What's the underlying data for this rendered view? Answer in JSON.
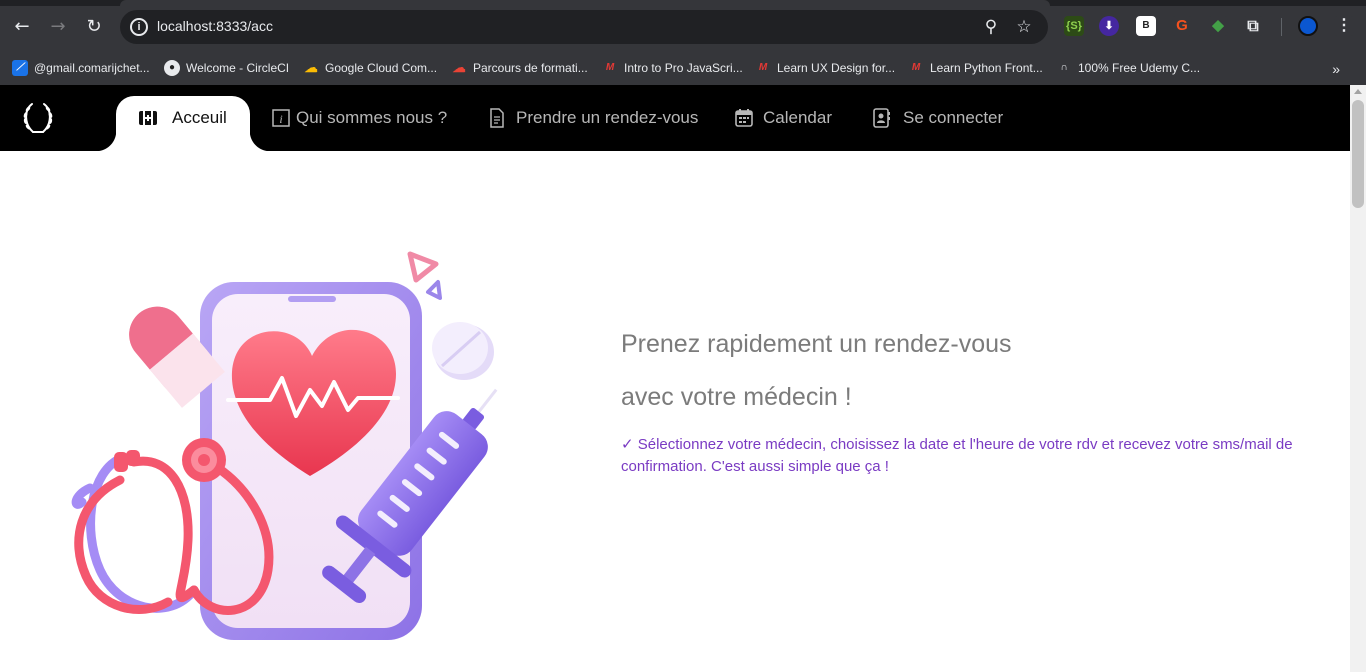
{
  "browser": {
    "url": "localhost:8333/acc",
    "bookmarks": [
      "@gmail.comarijchet...",
      "Welcome - CircleCI",
      "Google Cloud Com...",
      "Parcours de formati...",
      "Intro to Pro JavaScri...",
      "Learn UX Design for...",
      "Learn Python Front...",
      "100% Free Udemy C..."
    ]
  },
  "nav": {
    "items": [
      {
        "label": "Acceuil"
      },
      {
        "label": "Qui sommes nous ?"
      },
      {
        "label": "Prendre un rendez-vous"
      },
      {
        "label": "Calendar"
      },
      {
        "label": "Se connecter"
      }
    ]
  },
  "hero": {
    "line1": "Prenez rapidement un rendez-vous",
    "line2": "avec votre médecin !",
    "description": "✓ Sélectionnez votre médecin, choisissez la date et l'heure de votre rdv et recevez votre sms/mail de confirmation. C'est aussi simple que ça !"
  },
  "colors": {
    "accent": "#7a3bc3",
    "navbar": "#000000"
  }
}
